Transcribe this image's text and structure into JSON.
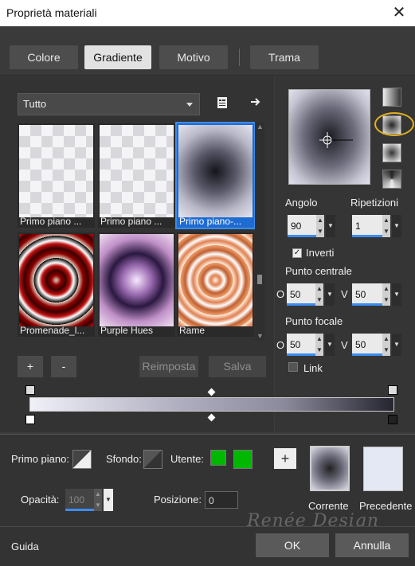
{
  "window": {
    "title": "Proprietà materiali",
    "close_glyph": "✕"
  },
  "tabs": [
    "Colore",
    "Gradiente",
    "Motivo",
    "Trama"
  ],
  "active_tab": "Gradiente",
  "category_dropdown": {
    "value": "Tutto"
  },
  "gradients": [
    {
      "label": "Primo piano ...",
      "style": "checker-light"
    },
    {
      "label": "Primo piano ...",
      "style": "checker-light"
    },
    {
      "label": "Primo piano-...",
      "style": "rect-dark",
      "selected": true
    },
    {
      "label": "Promenade_l...",
      "style": "rect-red"
    },
    {
      "label": "Purple Hues",
      "style": "rect-purple"
    },
    {
      "label": "Rame",
      "style": "rect-copper"
    }
  ],
  "list_buttons": {
    "add": "+",
    "remove": "-",
    "reset": "Reimposta",
    "save": "Salva"
  },
  "angle": {
    "label": "Angolo",
    "value": "90"
  },
  "repeats": {
    "label": "Ripetizioni",
    "value": "1"
  },
  "invert": {
    "label": "Inverti",
    "checked": true
  },
  "center_point": {
    "label": "Punto centrale",
    "h_prefix": "O",
    "h": "50",
    "v_prefix": "V",
    "v": "50"
  },
  "focal_point": {
    "label": "Punto focale",
    "h_prefix": "O",
    "h": "50",
    "v_prefix": "V",
    "v": "50"
  },
  "link": {
    "label": "Link",
    "checked": false
  },
  "foreground": {
    "label": "Primo piano:"
  },
  "background": {
    "label": "Sfondo:"
  },
  "user": {
    "label": "Utente:",
    "color": "#00b800"
  },
  "opacity": {
    "label": "Opacità:",
    "value": "100"
  },
  "position": {
    "label": "Posizione:",
    "value": "0"
  },
  "swap_button": "+",
  "current_label": "Corrente",
  "previous_label": "Precedente",
  "footer": {
    "help": "Guida",
    "ok": "OK",
    "cancel": "Annulla"
  },
  "watermark": "Renée Design",
  "accent_color": "#3b8cf0",
  "highlight_color": "#e0b020"
}
